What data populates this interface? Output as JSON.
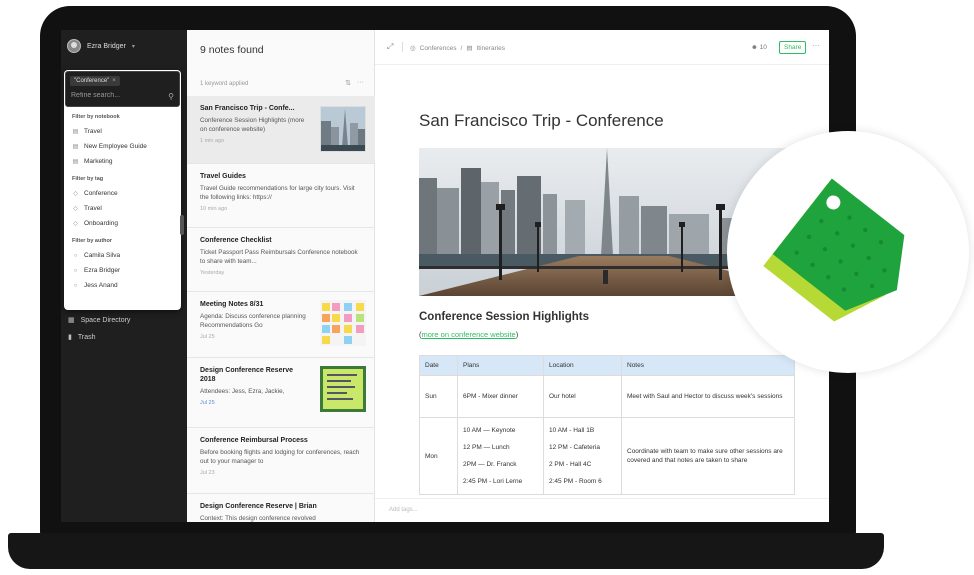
{
  "user": {
    "name": "Ezra Bridger"
  },
  "filter": {
    "active_chip": "\"Conference\"",
    "placeholder": "Refine search...",
    "sections": [
      {
        "heading": "Filter by notebook",
        "items": [
          "Travel",
          "New Employee Guide",
          "Marketing"
        ]
      },
      {
        "heading": "Filter by tag",
        "items": [
          "Conference",
          "Travel",
          "Onboarding"
        ]
      },
      {
        "heading": "Filter by author",
        "items": [
          "Camila Silva",
          "Ezra Bridger",
          "Jess Anand"
        ]
      }
    ]
  },
  "sidebar": {
    "nav": [
      {
        "label": "Space Directory",
        "icon": "building-icon"
      },
      {
        "label": "Trash",
        "icon": "trash-icon"
      }
    ]
  },
  "note_list": {
    "header": "9 notes found",
    "keyword_info": "1 keyword applied",
    "notes": [
      {
        "title": "San Francisco Trip - Confe...",
        "body": "Conference Session Highlights (more on conference website)",
        "date": "1 min ago"
      },
      {
        "title": "Travel Guides",
        "body": "Travel Guide recommendations for large city tours. Visit the following links: https://",
        "date": "10 min ago"
      },
      {
        "title": "Conference Checklist",
        "body": "Ticket Passport Pass Reimbursals Conference notebook to share with team...",
        "date": "Yesterday"
      },
      {
        "title": "Meeting Notes 8/31",
        "body": "Agenda: Discuss conference planning Recommendations Go",
        "date": "Jul 25"
      },
      {
        "title": "Design Conference Reserve 2018",
        "body": "Attendees: Jess, Ezra, Jackie,",
        "date": "Jul 25"
      },
      {
        "title": "Conference Reimbursal Process",
        "body": "Before booking flights and lodging for conferences, reach out to your manager to",
        "date": "Jul 23"
      },
      {
        "title": "Design Conference Reserve | Brian",
        "body": "Context: This design conference revolved",
        "date": ""
      }
    ]
  },
  "editor": {
    "breadcrumb": [
      "Conferences",
      "Itineraries"
    ],
    "share_count": "10",
    "share_label": "Share",
    "title": "San Francisco Trip - Conference",
    "section_heading": "Conference Session Highlights",
    "link_text": "more on conference website",
    "table": {
      "headers": [
        "Date",
        "Plans",
        "Location",
        "Notes"
      ],
      "rows": [
        {
          "date": "Sun",
          "plans": [
            "6PM - Mixer dinner"
          ],
          "locations": [
            "Our hotel"
          ],
          "notes": "Meet with Saul and Hector to discuss week's sessions"
        },
        {
          "date": "Mon",
          "plans": [
            "10 AM — Keynote",
            "12 PM — Lunch",
            "2PM — Dr. Franck",
            "2:45 PM - Lori Lerne"
          ],
          "locations": [
            "10 AM - Hall 1B",
            "12 PM - Cafeteria",
            "2 PM - Hall 4C",
            "2:45 PM - Room 6"
          ],
          "notes": "Coordinate with team to make sure other sessions are covered and that notes are taken to share"
        }
      ]
    },
    "tags_placeholder": "Add tags..."
  },
  "colors": {
    "accent": "#2dbe60",
    "sidebar": "#1f1f1f",
    "table_header": "#d6e7f7",
    "tag_front": "#1fa33c",
    "tag_back": "#b7d935"
  }
}
